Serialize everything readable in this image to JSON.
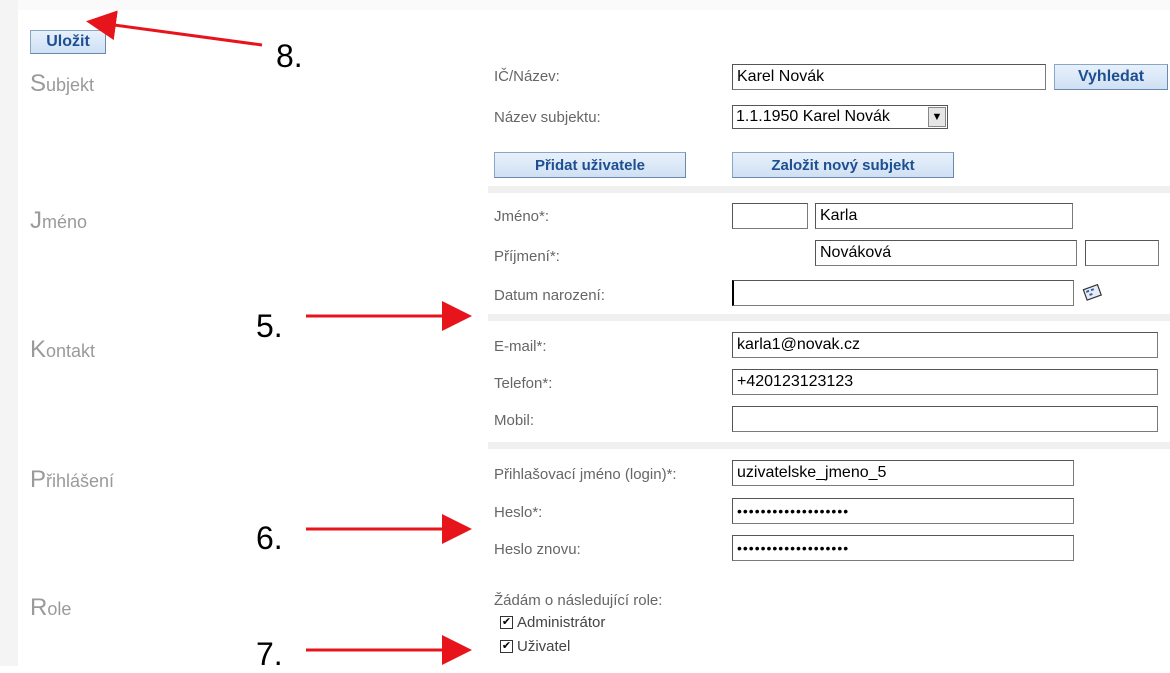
{
  "toolbar": {
    "save_label": "Uložit"
  },
  "sections": {
    "subjekt": {
      "initial": "S",
      "rest": "ubjekt"
    },
    "jmeno": {
      "initial": "J",
      "rest": "méno"
    },
    "kontakt": {
      "initial": "K",
      "rest": "ontakt"
    },
    "prihlaseni": {
      "initial": "P",
      "rest": "řihlášení"
    },
    "role": {
      "initial": "R",
      "rest": "ole"
    }
  },
  "subjekt": {
    "ic_label": "IČ/Název:",
    "ic_value": "Karel  Novák",
    "search_button": "Vyhledat",
    "nazev_label": "Název subjektu:",
    "nazev_selected": "1.1.1950 Karel Novák",
    "add_user_button": "Přidat uživatele",
    "new_subject_button": "Založit nový subjekt"
  },
  "jmeno": {
    "jmeno_label": "Jméno*:",
    "titul_pred_value": "",
    "jmeno_value": "Karla",
    "prijmeni_label": "Příjmení*:",
    "prijmeni_value": "Nováková",
    "titul_za_value": "",
    "datum_label": "Datum narození:",
    "datum_value": ""
  },
  "kontakt": {
    "email_label": "E-mail*:",
    "email_value": "karla1@novak.cz",
    "telefon_label": "Telefon*:",
    "telefon_value": "+420123123123",
    "mobil_label": "Mobil:",
    "mobil_value": ""
  },
  "prihlaseni": {
    "login_label": "Přihlašovací jméno (login)*:",
    "login_value": "uzivatelske_jmeno_5",
    "heslo_label": "Heslo*:",
    "heslo_value": "•••••••••••••••••••",
    "heslo2_label": "Heslo znovu:",
    "heslo2_value": "•••••••••••••••••••"
  },
  "role": {
    "intro": "Žádám o následující role:",
    "items": [
      {
        "label": "Administrátor",
        "checked": true
      },
      {
        "label": "Uživatel",
        "checked": true
      }
    ]
  },
  "annotations": {
    "a8": "8.",
    "a5": "5.",
    "a6": "6.",
    "a7": "7."
  },
  "icons": {
    "calendar": "calendar-icon",
    "dropdown": "chevron-down-icon",
    "check": "checkmark"
  },
  "colors": {
    "annotation_arrow": "#e8141b",
    "button_text": "#1d4f91"
  }
}
